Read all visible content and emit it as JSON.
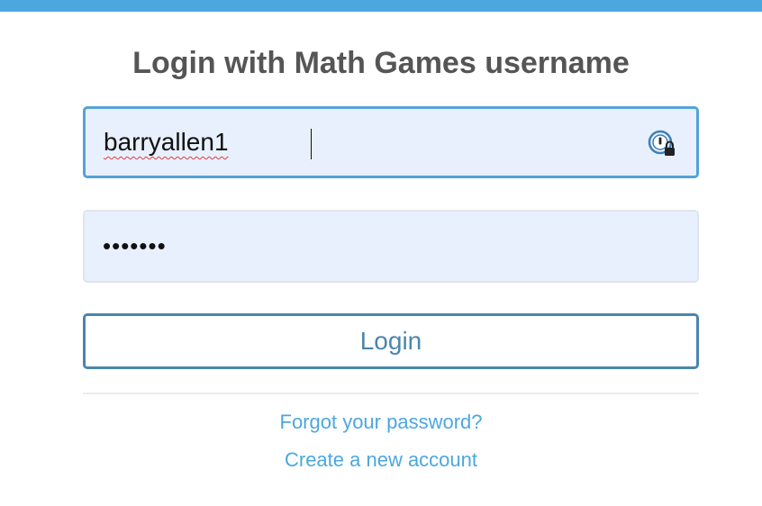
{
  "header": {
    "accent_color": "#4ca7df"
  },
  "login": {
    "title": "Login with Math Games username",
    "username_value": "barryallen1",
    "password_mask": "•••••••",
    "password_manager_icon": "password-manager-icon",
    "login_button_label": "Login",
    "button_color": "#4b86ad"
  },
  "links": {
    "forgot_password": "Forgot your password?",
    "create_account": "Create a new account",
    "link_color": "#4ca7df"
  }
}
